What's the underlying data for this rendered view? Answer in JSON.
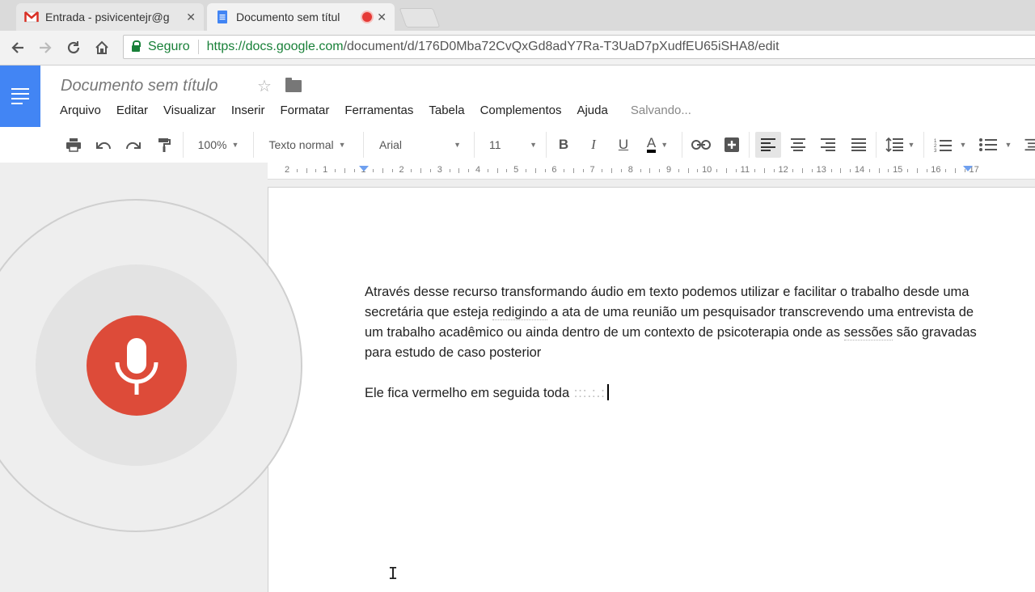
{
  "browser": {
    "tabs": [
      {
        "title": "Entrada - psivicentejr@g",
        "icon": "gmail-icon",
        "close": "✕"
      },
      {
        "title": "Documento sem títul",
        "icon": "docs-icon",
        "close": "✕",
        "recording": true
      }
    ],
    "security_label": "Seguro",
    "url_domain": "https://docs.google.com",
    "url_path": "/document/d/176D0Mba72CvQxGd8adY7Ra-T3UaD7pXudfEU65iSHA8/edit"
  },
  "docs": {
    "title": "Documento sem título",
    "menu": [
      "Arquivo",
      "Editar",
      "Visualizar",
      "Inserir",
      "Formatar",
      "Ferramentas",
      "Tabela",
      "Complementos",
      "Ajuda"
    ],
    "save_status": "Salvando...",
    "toolbar": {
      "zoom": "100%",
      "style": "Texto normal",
      "font": "Arial",
      "size": "11",
      "bold": "B",
      "italic": "I",
      "underline": "U",
      "text_color": "A"
    },
    "ruler_numbers": [
      "2",
      "1",
      "1",
      "2",
      "3",
      "4",
      "5",
      "6",
      "7",
      "8",
      "9",
      "10",
      "11",
      "12",
      "13",
      "14",
      "15",
      "16",
      "17"
    ]
  },
  "document": {
    "p1_a": "Através desse recurso transformando áudio em texto podemos utilizar e facilitar o trabalho desde uma secretária que esteja ",
    "p1_w1": "redigindo",
    "p1_b": " a ata de uma reunião um pesquisador transcrevendo uma entrevista de um trabalho acadêmico ou ainda dentro de um contexto de psicoterapia onde as ",
    "p1_w2": "sessões",
    "p1_c": " são gravadas para estudo de caso posterior",
    "p2": "Ele fica vermelho em seguida toda",
    "p2_pending": " :::.:.:"
  },
  "voice": {
    "icon": "microphone-icon",
    "color": "#dd4b39"
  },
  "colors": {
    "docs_blue": "#4285f4",
    "secure_green": "#188038"
  }
}
